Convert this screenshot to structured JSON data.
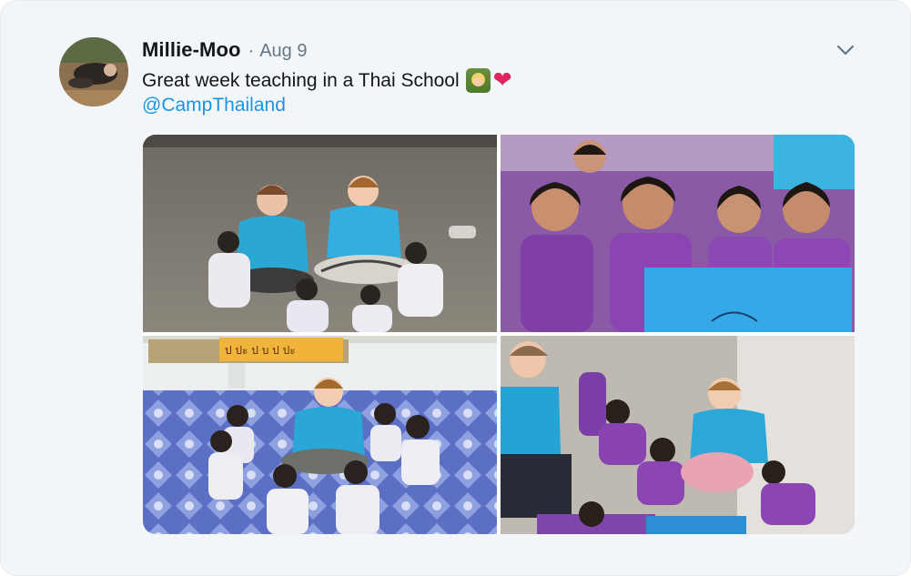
{
  "tweet": {
    "author_name": "Millie-Moo",
    "separator": "·",
    "date": "Aug 9",
    "text": "Great week teaching in a Thai School",
    "emojis": [
      "teacher-emoji",
      "red-heart-emoji"
    ],
    "mention": "@CampThailand"
  },
  "media": {
    "photos": [
      {
        "name": "photo-1",
        "description_icon": "image"
      },
      {
        "name": "photo-2",
        "description_icon": "image"
      },
      {
        "name": "photo-3",
        "description_icon": "image"
      },
      {
        "name": "photo-4",
        "description_icon": "image"
      }
    ],
    "sign_text": "ป ปะ ป บ ป ปะ"
  },
  "colors": {
    "mention": "#1b95e0",
    "heart": "#e0245e",
    "meta": "#657786",
    "card_background": "#f3f6f9"
  },
  "icons": {
    "caret": "chevron-down-icon"
  }
}
